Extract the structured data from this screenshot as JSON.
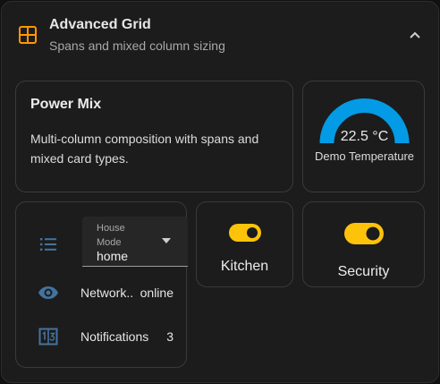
{
  "header": {
    "title": "Advanced Grid",
    "subtitle": "Spans and mixed column sizing",
    "icon": "grid-icon",
    "accent_color": "#ff9800"
  },
  "power_card": {
    "title": "Power Mix",
    "text": "Multi-column composition with spans and mixed card types."
  },
  "gauge_card": {
    "value": "22.5 °C",
    "name": "Demo Temperature",
    "fill_fraction": 1.0,
    "color": "#039be5"
  },
  "entities_card": {
    "select": {
      "label": "House Mode",
      "value": "home",
      "icon": "format-list-icon"
    },
    "rows": [
      {
        "name": "Network...",
        "state": "online",
        "icon": "eye-icon"
      },
      {
        "name": "Notifications",
        "state": "3",
        "icon": "counter-icon"
      }
    ],
    "icon_color": "#44739e"
  },
  "tiles": [
    {
      "label": "Kitchen",
      "state": "on",
      "icon": "toggle-switch-icon"
    },
    {
      "label": "Security",
      "state": "on",
      "icon": "toggle-switch-icon"
    }
  ],
  "colors": {
    "toggle_on": "#fdc30b"
  }
}
